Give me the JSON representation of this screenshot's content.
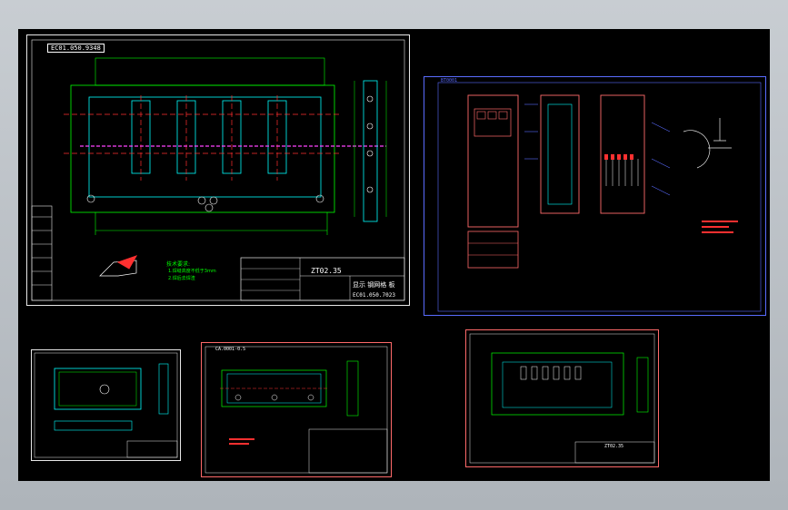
{
  "viewer": {
    "background": "#000000",
    "colors": {
      "frame_white": "#e8e8e8",
      "frame_red": "#ff6a6a",
      "frame_blue": "#5a6cff",
      "cad_green": "#00ff00",
      "cad_cyan": "#00ffff",
      "cad_red": "#ff3030",
      "cad_magenta": "#ff44ff",
      "cad_yellow": "#ffff00"
    }
  },
  "sheet1": {
    "tag": "EC01.050.9348",
    "code": "ZT02.35",
    "title": "显示 钢网格 板",
    "drawing_no": "EC01.050.7023",
    "note_title": "技术要求:",
    "note_lines": [
      "1.焊缝高度不低于3mm",
      "2.焊后去焊渣"
    ]
  },
  "sheet2": {
    "tag": "BT0001"
  },
  "sheet3": {},
  "sheet4": {
    "tag": "CA.0001-0.5"
  },
  "sheet5": {
    "code": "ZT02.35"
  }
}
